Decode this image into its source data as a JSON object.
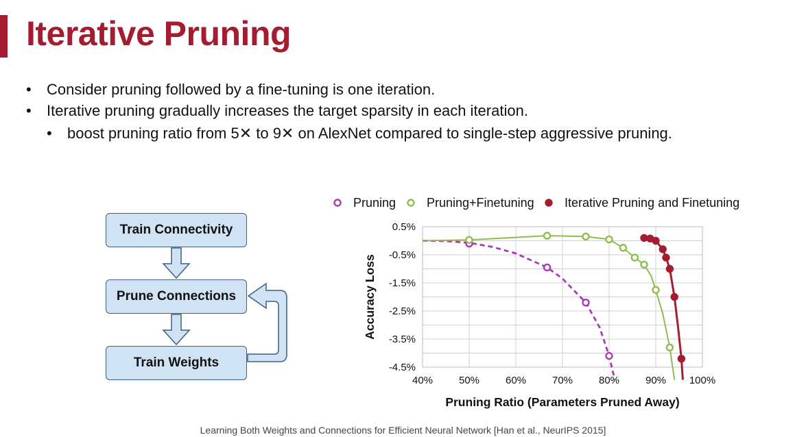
{
  "slide": {
    "title": "Iterative Pruning",
    "bullets": [
      "Consider pruning followed by a fine-tuning is one iteration.",
      "Iterative pruning gradually increases the target sparsity in each iteration.",
      "boost pruning ratio from 5✕ to 9✕ on AlexNet compared to single-step aggressive pruning."
    ],
    "bullet_symbol": "•",
    "citation": "Learning Both Weights and Connections for Efficient Neural Network [Han et al., NeurIPS 2015]"
  },
  "flowchart": {
    "steps": [
      "Train Connectivity",
      "Prune Connections",
      "Train Weights"
    ],
    "colors": {
      "fill": "#cfe3f5",
      "border": "#3e5f7e"
    }
  },
  "chart_data": {
    "type": "line",
    "xlabel": "Pruning Ratio (Parameters Pruned Away)",
    "ylabel": "Accuracy Loss",
    "xlim": [
      40,
      100
    ],
    "ylim": [
      -4.5,
      0.5
    ],
    "xticks": [
      40,
      50,
      60,
      70,
      80,
      90,
      100
    ],
    "xtick_labels": [
      "40%",
      "50%",
      "60%",
      "70%",
      "80%",
      "90%",
      "100%"
    ],
    "yticks": [
      0.5,
      -0.5,
      -1.5,
      -2.5,
      -3.5,
      -4.5
    ],
    "ytick_labels": [
      "0.5%",
      "-0.5%",
      "-1.5%",
      "-2.5%",
      "-3.5%",
      "-4.5%"
    ],
    "grid": true,
    "legend": "top",
    "series": [
      {
        "name": "Pruning",
        "color": "#a83ab3",
        "line_style": "dashed",
        "marker": "open-circle",
        "points": [
          [
            50,
            -0.1
          ],
          [
            66.7,
            -0.95
          ],
          [
            75,
            -2.2
          ],
          [
            80,
            -4.1
          ]
        ],
        "curve": [
          [
            40,
            0.0
          ],
          [
            45,
            -0.01
          ],
          [
            50,
            -0.07
          ],
          [
            55,
            -0.22
          ],
          [
            60,
            -0.45
          ],
          [
            66.7,
            -0.95
          ],
          [
            70,
            -1.35
          ],
          [
            75,
            -2.2
          ],
          [
            78,
            -3.1
          ],
          [
            80,
            -4.1
          ],
          [
            81.2,
            -4.95
          ]
        ]
      },
      {
        "name": "Pruning+Finetuning",
        "color": "#8dbd4f",
        "line_style": "solid",
        "marker": "open-circle",
        "points": [
          [
            50,
            0.03
          ],
          [
            66.7,
            0.18
          ],
          [
            75,
            0.15
          ],
          [
            80,
            0.05
          ],
          [
            83,
            -0.25
          ],
          [
            85.5,
            -0.6
          ],
          [
            87.5,
            -0.85
          ],
          [
            90,
            -1.75
          ],
          [
            93,
            -3.8
          ]
        ],
        "curve": [
          [
            40,
            0.0
          ],
          [
            50,
            0.03
          ],
          [
            60,
            0.12
          ],
          [
            66.7,
            0.18
          ],
          [
            75,
            0.15
          ],
          [
            80,
            0.05
          ],
          [
            83,
            -0.25
          ],
          [
            85.5,
            -0.6
          ],
          [
            87.5,
            -0.85
          ],
          [
            89,
            -1.25
          ],
          [
            90,
            -1.75
          ],
          [
            91.5,
            -2.6
          ],
          [
            93,
            -3.8
          ],
          [
            94,
            -4.95
          ]
        ]
      },
      {
        "name": "Iterative Pruning and Finetuning",
        "color": "#a51c30",
        "line_style": "solid",
        "marker": "filled-circle",
        "points": [
          [
            87.5,
            0.1
          ],
          [
            88.8,
            0.08
          ],
          [
            90,
            0.0
          ],
          [
            91.5,
            -0.3
          ],
          [
            92.2,
            -0.6
          ],
          [
            93,
            -1.0
          ],
          [
            94,
            -2.0
          ],
          [
            95.5,
            -4.2
          ]
        ],
        "curve": [
          [
            87.5,
            0.1
          ],
          [
            88.8,
            0.08
          ],
          [
            90,
            0.0
          ],
          [
            91.5,
            -0.3
          ],
          [
            92.2,
            -0.6
          ],
          [
            93,
            -1.0
          ],
          [
            94,
            -2.0
          ],
          [
            94.8,
            -3.1
          ],
          [
            95.5,
            -4.2
          ],
          [
            95.8,
            -4.95
          ]
        ]
      }
    ]
  }
}
